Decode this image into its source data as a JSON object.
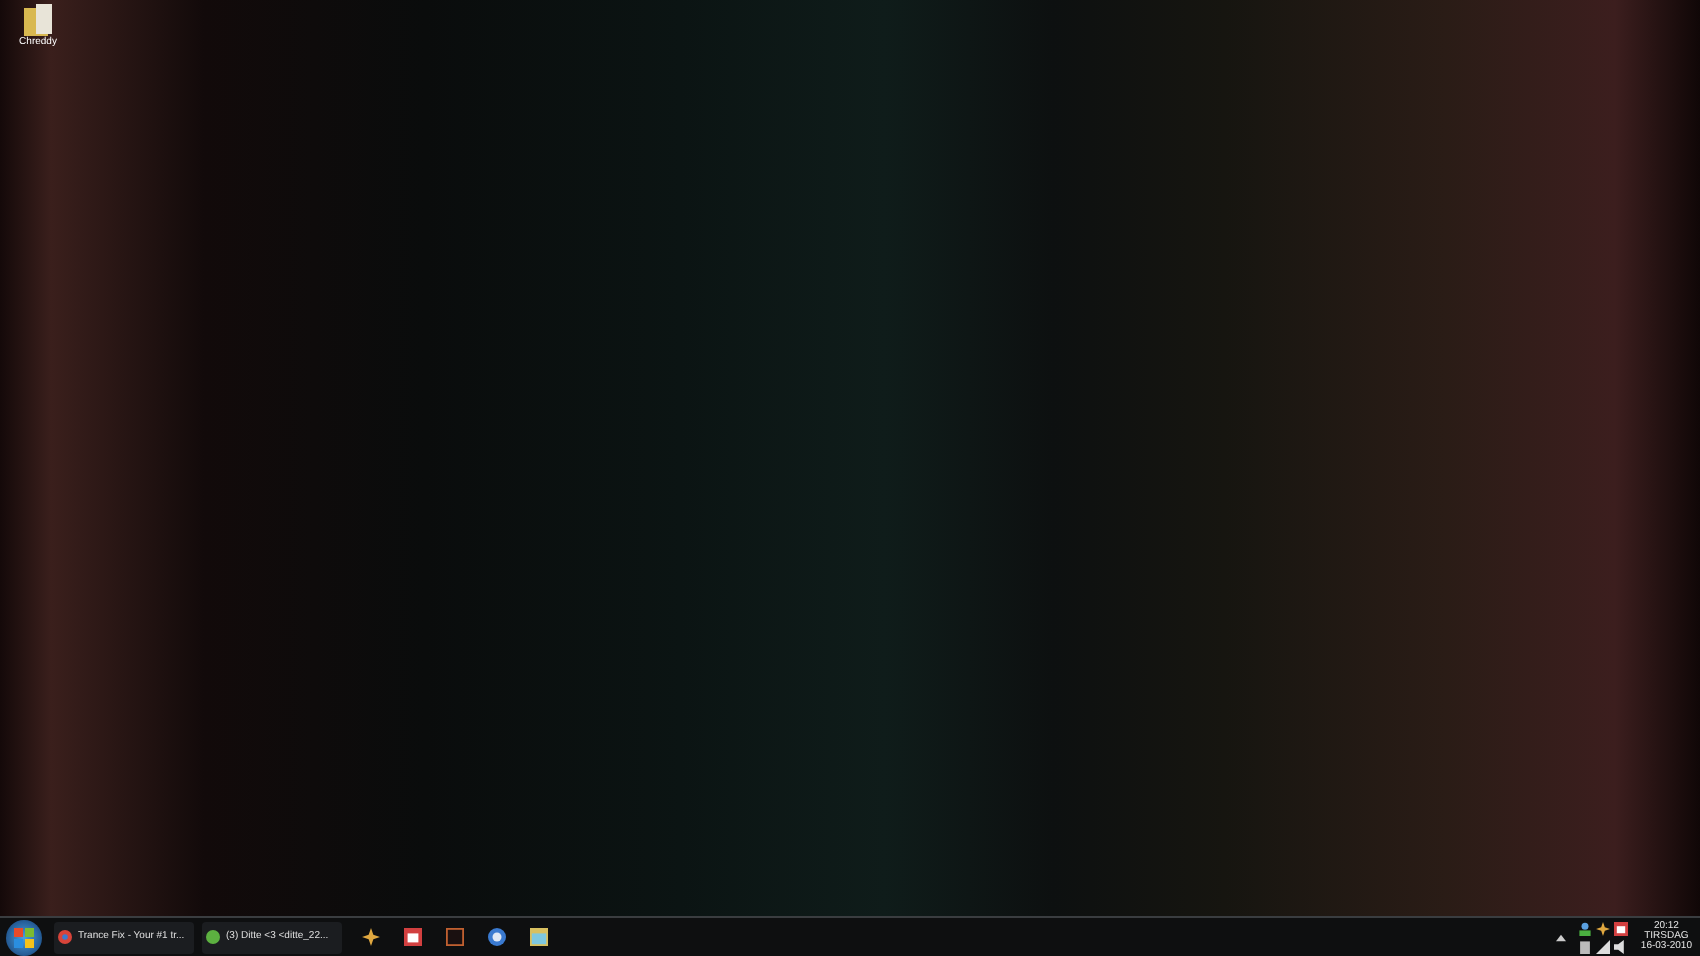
{
  "desktop_icons": [
    {
      "label": "Chreddy"
    }
  ],
  "taskbar": {
    "tasks": [
      {
        "label": "Trance Fix - Your #1 tr..."
      },
      {
        "label": "(3) Ditte <3 <ditte_22..."
      }
    ],
    "clock": {
      "time": "20:12",
      "day": "TIRSDAG",
      "date": "16-03-2010"
    }
  }
}
